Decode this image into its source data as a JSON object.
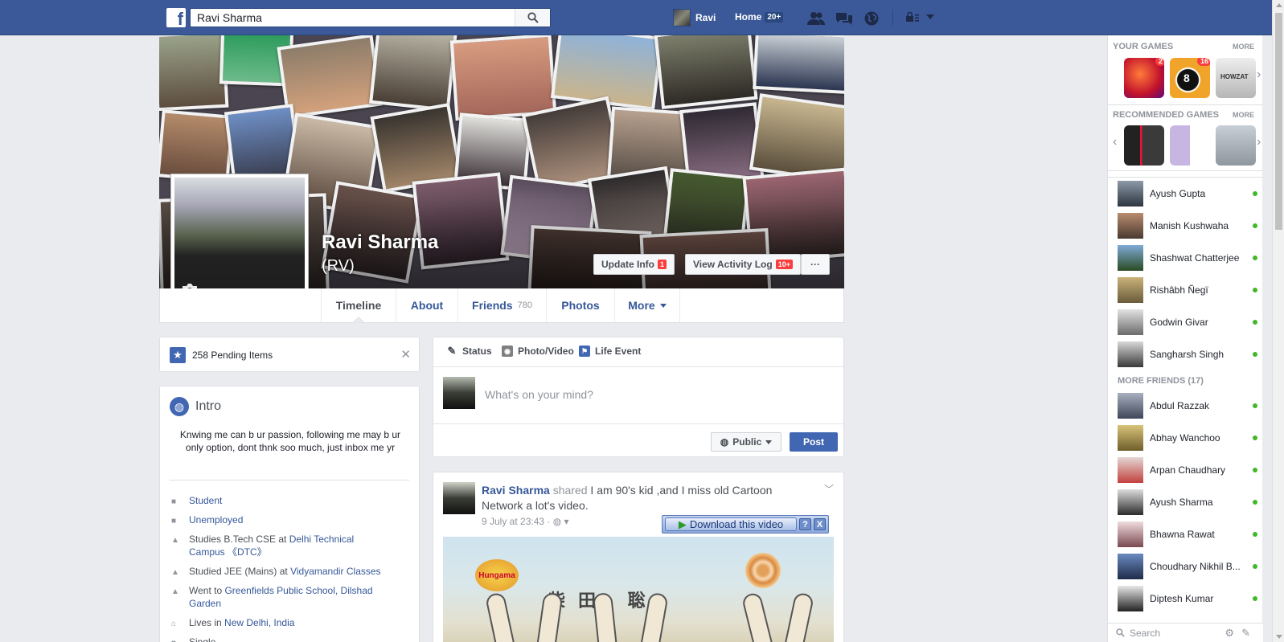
{
  "topbar": {
    "logo": "f",
    "search_value": "Ravi Sharma",
    "user_name": "Ravi",
    "home_label": "Home",
    "home_badge": "20+"
  },
  "profile": {
    "name": "Ravi Sharma",
    "nickname": "(RV)",
    "update_info_label": "Update Info",
    "update_info_badge": "1",
    "activity_log_label": "View Activity Log",
    "activity_log_badge": "10+",
    "more_dots": "···"
  },
  "tabs": {
    "timeline": "Timeline",
    "about": "About",
    "friends": "Friends",
    "friends_count": "780",
    "photos": "Photos",
    "more": "More"
  },
  "pending": {
    "text": "258 Pending Items"
  },
  "intro": {
    "title": "Intro",
    "bio": "Knwing me can b ur passion, following me may b ur only option, dont thnk soo much, just inbox me yr",
    "rows": [
      {
        "pre": "Student",
        "link": "",
        "post": ""
      },
      {
        "pre": "Unemployed",
        "link": "",
        "post": ""
      },
      {
        "pre": "Studies B.Tech CSE at ",
        "link": "Delhi Technical Campus 《DTC》",
        "post": ""
      },
      {
        "pre": "Studied JEE (Mains) at ",
        "link": "Vidyamandir Classes",
        "post": ""
      },
      {
        "pre": "Went to ",
        "link": "Greenfields Public School, Dilshad Garden",
        "post": ""
      },
      {
        "pre": "Lives in ",
        "link": "New Delhi, India",
        "post": ""
      },
      {
        "pre": "Single",
        "link": "",
        "post": ""
      }
    ]
  },
  "composer": {
    "tab_status": "Status",
    "tab_photo": "Photo/Video",
    "tab_life": "Life Event",
    "placeholder": "What's on your mind?",
    "privacy": "Public",
    "post_label": "Post"
  },
  "feed_post": {
    "author": "Ravi Sharma",
    "action": "shared",
    "text": "I am 90's kid ,and I miss old Cartoon Network a lot's video.",
    "date": "9 July at 23:43",
    "download_label": "Download this video",
    "help": "?",
    "close": "X",
    "video_logo": "Hungama",
    "video_text": "柴田 聡"
  },
  "rail": {
    "your_games": "YOUR GAMES",
    "recommended_games": "RECOMMENDED GAMES",
    "more": "MORE",
    "games": [
      {
        "name": "candy-crush",
        "badge": "2"
      },
      {
        "name": "8-ball-pool",
        "badge": "16"
      },
      {
        "name": "howzat-cricket",
        "badge": ""
      }
    ],
    "recommended": [
      "stack-game",
      "pipes-game",
      "stick-cricket"
    ],
    "friends": [
      "Ayush Gupta",
      "Manish Kushwaha",
      "Shashwat Chatterjee",
      "Rishâbh Ñegï",
      "Godwin Givar",
      "Sangharsh Singh"
    ],
    "more_friends_label": "MORE FRIENDS (17)",
    "more_friends": [
      "Abdul Razzak",
      "Abhay Wanchoo",
      "Arpan Chaudhary",
      "Ayush Sharma",
      "Bhawna Rawat",
      "Choudhary Nikhil B...",
      "Diptesh Kumar"
    ],
    "search_placeholder": "Search"
  },
  "colors": {
    "brand": "#3b5998",
    "link": "#365899",
    "online": "#42b72a",
    "badge": "#fa3e3e"
  }
}
